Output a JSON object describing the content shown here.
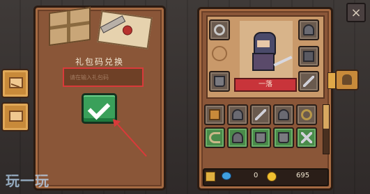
{
  "redeem": {
    "title": "礼包码兑换",
    "input_placeholder": "请在输入礼包码"
  },
  "character": {
    "name_banner": "一落"
  },
  "currency": {
    "gems": "0",
    "coins": "695"
  },
  "close_label": "×",
  "watermark": "玩一玩",
  "scroll_position": 0.0,
  "colors": {
    "confirm_green": "#3aa05a",
    "highlight_red": "#d93a3a",
    "panel_brown": "#8a5638"
  }
}
